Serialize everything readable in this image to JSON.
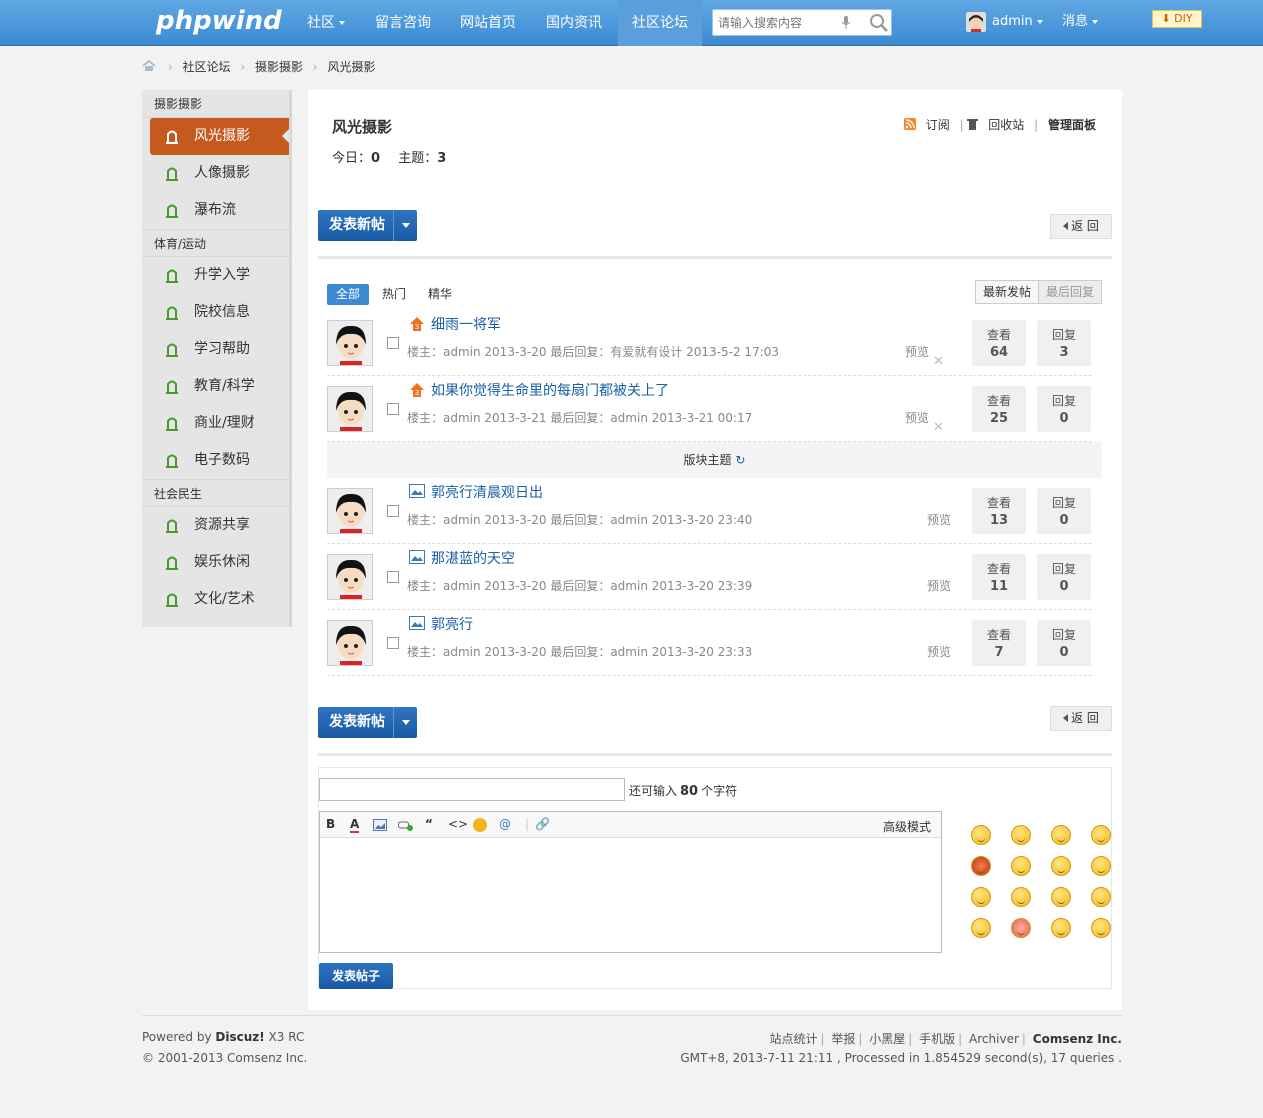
{
  "header": {
    "logo": "phpwind",
    "nav": [
      {
        "label": "社区",
        "dropdown": true
      },
      {
        "label": "留言咨询"
      },
      {
        "label": "网站首页"
      },
      {
        "label": "国内资讯"
      },
      {
        "label": "社区论坛",
        "active": true
      }
    ],
    "search_placeholder": "请输入搜索内容",
    "username": "admin",
    "messages": "消息",
    "diy": "DIY"
  },
  "breadcrumb": [
    "社区论坛",
    "摄影摄影",
    "风光摄影"
  ],
  "sidebar": {
    "groups": [
      {
        "title": "摄影摄影",
        "items": [
          "风光摄影",
          "人像摄影",
          "瀑布流"
        ]
      },
      {
        "title": "体育/运动",
        "items": [
          "升学入学",
          "院校信息",
          "学习帮助",
          "教育/科学",
          "商业/理财",
          "电子数码"
        ]
      },
      {
        "title": "社会民生",
        "items": [
          "资源共享",
          "娱乐休闲",
          "文化/艺术"
        ]
      }
    ]
  },
  "forum": {
    "title": "风光摄影",
    "today_label": "今日：",
    "today_value": "0",
    "topics_label": "主题：",
    "topics_value": "3",
    "actions": [
      "订阅",
      "回收站",
      "管理面板"
    ],
    "new_post": "发表新帖",
    "back": "返 回"
  },
  "tabs": [
    "全部",
    "热门",
    "精华"
  ],
  "sort": [
    "最新发帖",
    "最后回复"
  ],
  "sticky_section": "版块主题",
  "threads": [
    {
      "title": "细雨一将军",
      "meta": "楼主：admin 2013-3-20    最后回复：有爱就有设计 2013-5-2 17:03",
      "preview": "预览",
      "views_label": "查看",
      "views": "64",
      "replies_label": "回复",
      "replies": "3",
      "pinned": true
    },
    {
      "title": "如果你觉得生命里的每扇门都被关上了",
      "meta": "楼主：admin 2013-3-21    最后回复：admin 2013-3-21 00:17",
      "preview": "预览",
      "views_label": "查看",
      "views": "25",
      "replies_label": "回复",
      "replies": "0",
      "pinned": true
    },
    {
      "title": "郭亮行清晨观日出",
      "meta": "楼主：admin 2013-3-20    最后回复：admin 2013-3-20 23:40",
      "preview": "预览",
      "views_label": "查看",
      "views": "13",
      "replies_label": "回复",
      "replies": "0",
      "pinned": false
    },
    {
      "title": "那湛蓝的天空",
      "meta": "楼主：admin 2013-3-20    最后回复：admin 2013-3-20 23:39",
      "preview": "预览",
      "views_label": "查看",
      "views": "11",
      "replies_label": "回复",
      "replies": "0",
      "pinned": false
    },
    {
      "title": "郭亮行",
      "meta": "楼主：admin 2013-3-20    最后回复：admin 2013-3-20 23:33",
      "preview": "预览",
      "views_label": "查看",
      "views": "7",
      "replies_label": "回复",
      "replies": "0",
      "pinned": false
    }
  ],
  "reply": {
    "count_prefix": "还可输入",
    "count_value": "80",
    "count_suffix": "个字符",
    "advanced": "高级模式",
    "submit": "发表帖子",
    "tools": [
      "B",
      "A",
      "image",
      "link",
      "“",
      "<>",
      "smile",
      "@",
      "attach"
    ]
  },
  "footer": {
    "powered_prefix": "Powered by ",
    "powered_name": "Discuz!",
    "powered_version": " X3 RC",
    "copyright": "© 2001-2013 Comsenz Inc.",
    "links": [
      "站点统计",
      "举报",
      "小黑屋",
      "手机版",
      "Archiver",
      "Comsenz Inc."
    ],
    "debug": "GMT+8, 2013-7-11 21:11 , Processed in 1.854529 second(s), 17 queries ."
  },
  "colors": {
    "nav_blue": "#3d8ad4",
    "active_orange": "#c6591e",
    "link_blue": "#1a5fa8"
  }
}
